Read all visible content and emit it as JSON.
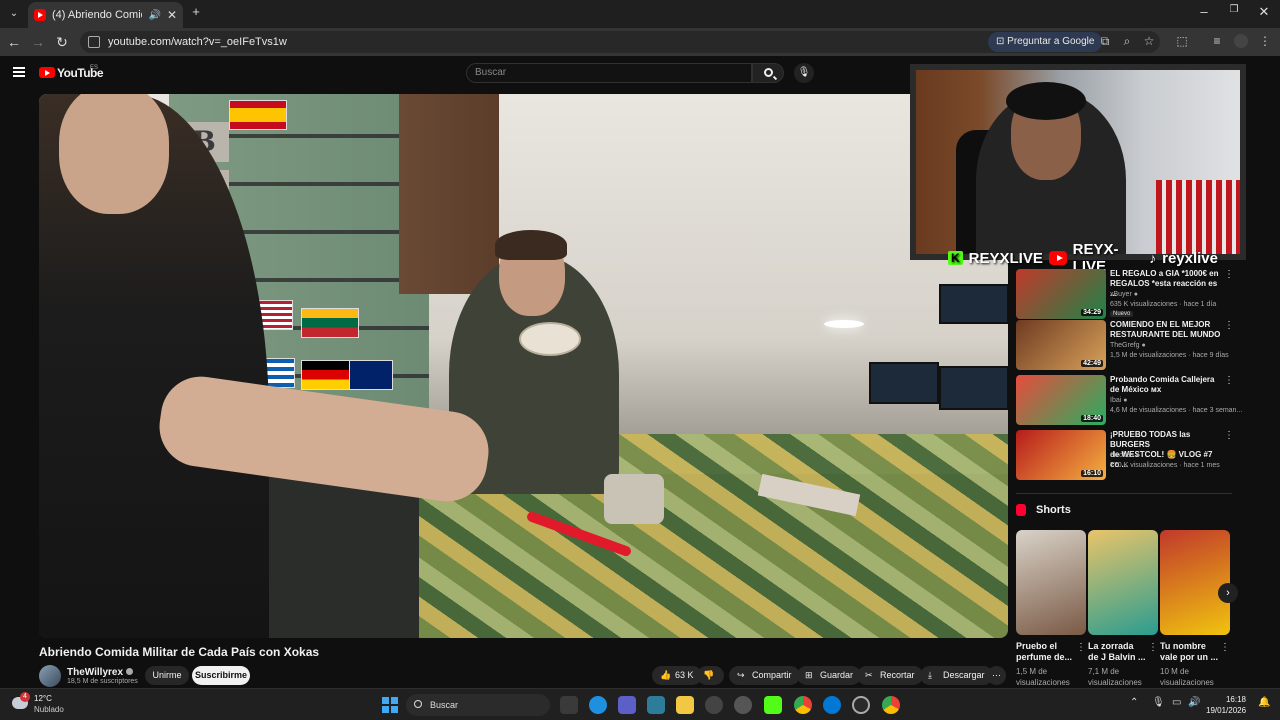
{
  "browser": {
    "tab_title": "(4) Abriendo Comida Milita",
    "url": "youtube.com/watch?v=_oeIFeTvs1w",
    "ask_google": "Preguntar a Google"
  },
  "youtube": {
    "logo_text": "YouTube",
    "region": "ES",
    "search_placeholder": "Buscar"
  },
  "overlay": {
    "kick": "K",
    "kick_name": "REYXLIVE",
    "yt_name": "REYX-LIVE",
    "tiktok_name": "reyxlive"
  },
  "video": {
    "title": "Abriendo Comida Militar de Cada País con Xokas",
    "channel": "TheWillyrex",
    "subscribers": "18,5 M de suscriptores",
    "join_label": "Unirme",
    "subscribe_label": "Suscribirme",
    "likes": "63 K",
    "share_label": "Compartir",
    "save_label": "Guardar",
    "clip_label": "Recortar",
    "download_label": "Descargar"
  },
  "recommendations": [
    {
      "title_line1": "EL REGALO a GIA *1000€ en",
      "title_line2": "REGALOS *esta reacción es ...",
      "channel": "xBuyer",
      "meta": "635 K visualizaciones · hace 1 día",
      "badge": "Nuevo",
      "duration": "34:29",
      "colors": [
        "#c0392b",
        "#1e8449"
      ]
    },
    {
      "title_line1": "COMIENDO EN EL MEJOR",
      "title_line2": "RESTAURANTE DEL MUNDO",
      "channel": "TheGrefg",
      "meta": "1,5 M de visualizaciones · hace 9 días",
      "badge": "",
      "duration": "42:49",
      "colors": [
        "#6e3b22",
        "#d8a15a"
      ]
    },
    {
      "title_line1": "Probando Comida Callejera",
      "title_line2": "de México мх",
      "channel": "Ibai",
      "meta": "4,6 M de visualizaciones · hace 3 seman...",
      "badge": "",
      "duration": "18:40",
      "colors": [
        "#e74c3c",
        "#27ae60"
      ]
    },
    {
      "title_line1": "¡PRUEBO TODAS las BURGERS",
      "title_line2": "de WESTCOL! 🍔 VLOG #7 co ...",
      "channel": "elxokas",
      "meta": "770 K visualizaciones · hace 1 mes",
      "badge": "",
      "duration": "16:10",
      "colors": [
        "#b71c1c",
        "#f5b041"
      ]
    }
  ],
  "shorts": {
    "heading": "Shorts",
    "items": [
      {
        "title_line1": "Pruebo el",
        "title_line2": "perfume de...",
        "views_line1": "1,5 M de",
        "views_line2": "visualizaciones",
        "colors": [
          "#d9d2c8",
          "#7a5a45"
        ]
      },
      {
        "title_line1": "La zorrada",
        "title_line2": "de J Balvin ...",
        "views_line1": "7,1 M de",
        "views_line2": "visualizaciones",
        "colors": [
          "#e9c46a",
          "#2a9d8f"
        ]
      },
      {
        "title_line1": "Tu nombre",
        "title_line2": "vale por un ...",
        "views_line1": "10 M de",
        "views_line2": "visualizaciones",
        "colors": [
          "#c0392b",
          "#f1c40f"
        ]
      }
    ]
  },
  "taskbar": {
    "temperature": "12°C",
    "condition": "Nublado",
    "weather_badge": "4",
    "search_label": "Buscar",
    "time": "16:18",
    "date": "19/01/2026"
  }
}
